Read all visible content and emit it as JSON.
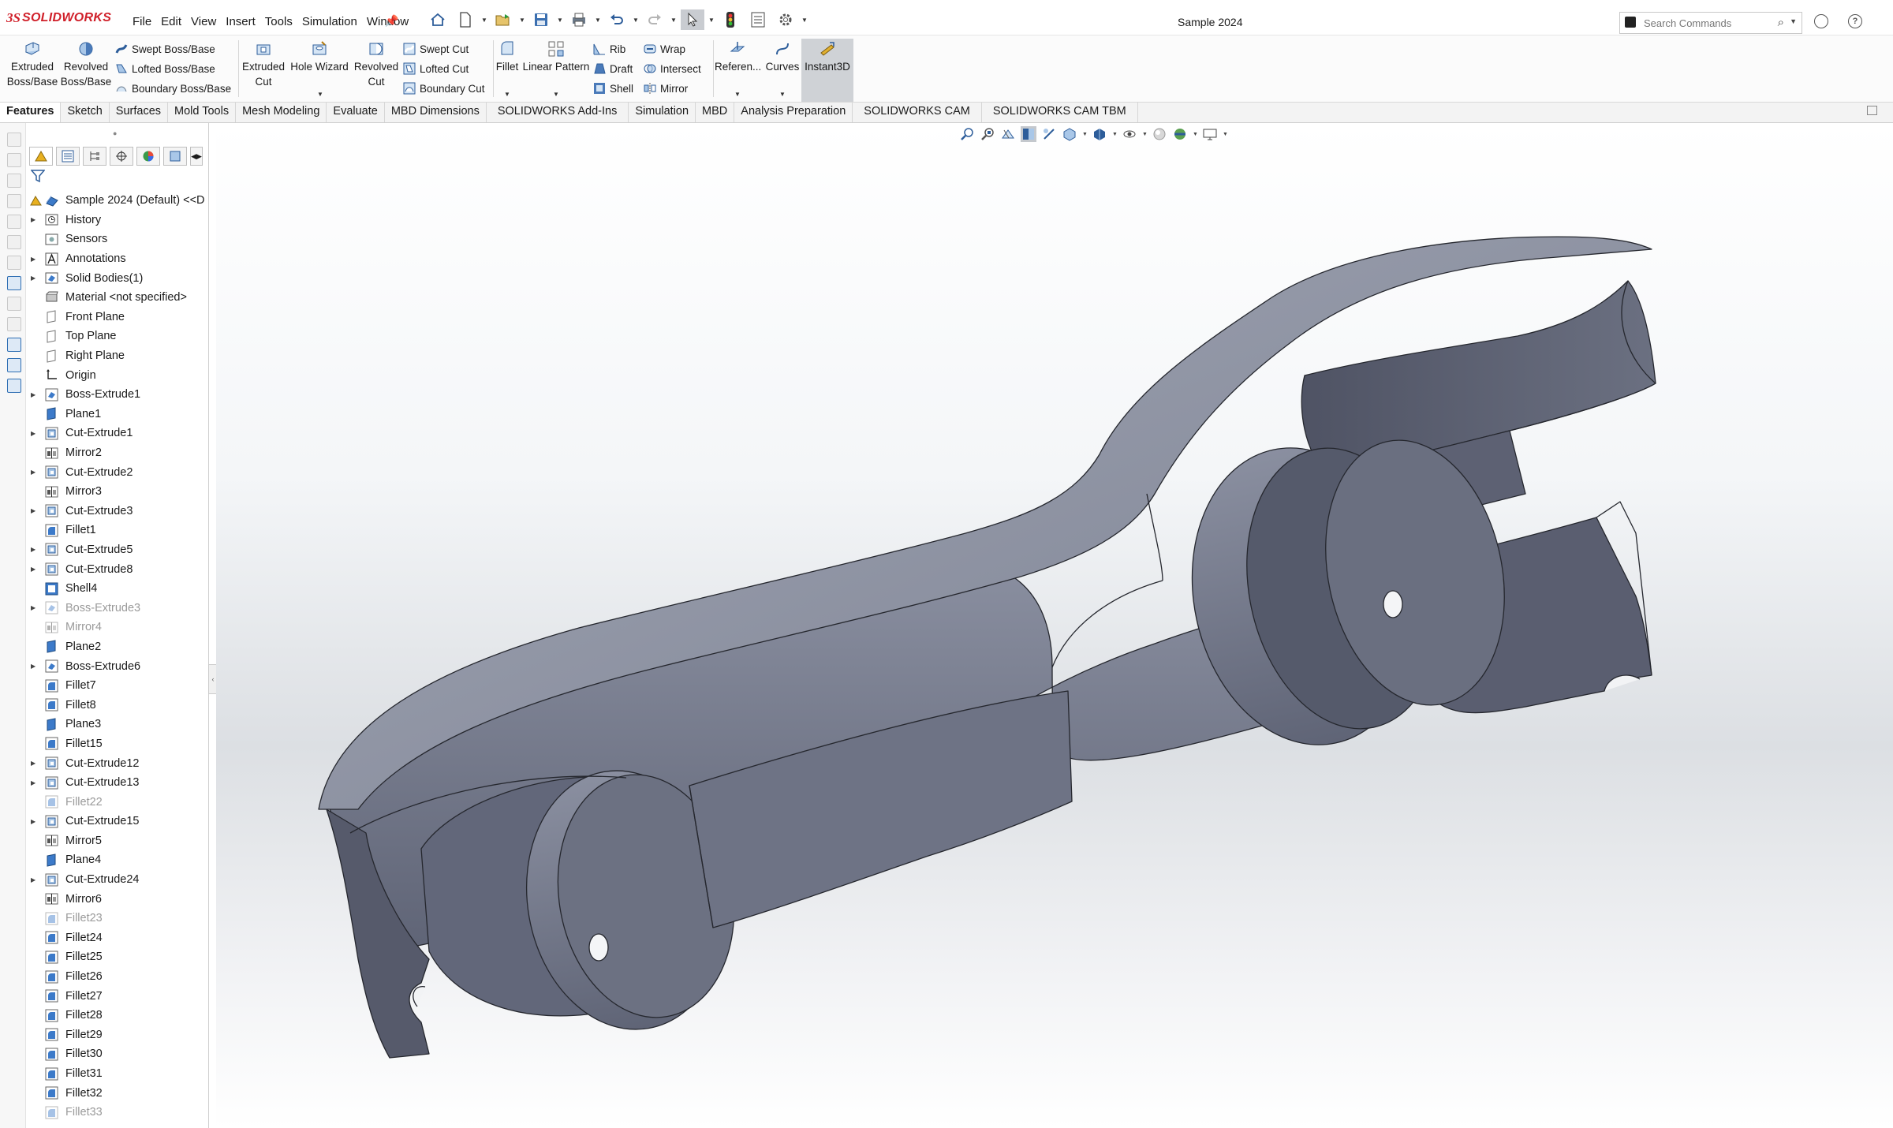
{
  "app": {
    "logo_ds": "3S",
    "logo_text": "SOLIDWORKS",
    "document_title": "Sample 2024"
  },
  "menu": [
    "File",
    "Edit",
    "View",
    "Insert",
    "Tools",
    "Simulation",
    "Window"
  ],
  "quick_access_icons": [
    "home-icon",
    "new-document-icon",
    "open-icon",
    "save-icon",
    "print-icon",
    "undo-icon",
    "redo-icon",
    "select-icon",
    "rebuild-icon",
    "file-properties-icon",
    "options-icon"
  ],
  "search": {
    "placeholder": "Search Commands"
  },
  "ribbon": {
    "extruded_boss": [
      "Extruded",
      "Boss/Base"
    ],
    "revolved_boss": [
      "Revolved",
      "Boss/Base"
    ],
    "swept_boss": "Swept Boss/Base",
    "lofted_boss": "Lofted Boss/Base",
    "boundary_boss": "Boundary Boss/Base",
    "extruded_cut": [
      "Extruded",
      "Cut"
    ],
    "hole_wizard": "Hole Wizard",
    "revolved_cut": [
      "Revolved",
      "Cut"
    ],
    "swept_cut": "Swept Cut",
    "lofted_cut": "Lofted Cut",
    "boundary_cut": "Boundary Cut",
    "fillet": "Fillet",
    "linear_pattern": "Linear Pattern",
    "rib": "Rib",
    "draft": "Draft",
    "shell": "Shell",
    "wrap": "Wrap",
    "intersect": "Intersect",
    "mirror": "Mirror",
    "reference": "Referen...",
    "curves": "Curves",
    "instant3d": "Instant3D"
  },
  "tabs": [
    {
      "label": "Features",
      "active": true
    },
    {
      "label": "Sketch"
    },
    {
      "label": "Surfaces"
    },
    {
      "label": "Mold Tools"
    },
    {
      "label": "Mesh Modeling"
    },
    {
      "label": "Evaluate"
    },
    {
      "label": "MBD Dimensions"
    },
    {
      "label": "SOLIDWORKS Add-Ins"
    },
    {
      "label": "Simulation"
    },
    {
      "label": "MBD"
    },
    {
      "label": "Analysis Preparation"
    },
    {
      "label": "SOLIDWORKS CAM"
    },
    {
      "label": "SOLIDWORKS CAM TBM"
    }
  ],
  "tree": {
    "root": "Sample 2024 (Default) <<D",
    "items": [
      {
        "label": "History",
        "icon": "history-icon",
        "expandable": true
      },
      {
        "label": "Sensors",
        "icon": "sensor-icon"
      },
      {
        "label": "Annotations",
        "icon": "annotation-icon",
        "expandable": true
      },
      {
        "label": "Solid Bodies(1)",
        "icon": "solid-bodies-icon",
        "expandable": true
      },
      {
        "label": "Material <not specified>",
        "icon": "material-icon"
      },
      {
        "label": "Front Plane",
        "icon": "plane-icon"
      },
      {
        "label": "Top Plane",
        "icon": "plane-icon"
      },
      {
        "label": "Right Plane",
        "icon": "plane-icon"
      },
      {
        "label": "Origin",
        "icon": "origin-icon"
      },
      {
        "label": "Boss-Extrude1",
        "icon": "extrude-icon",
        "expandable": true
      },
      {
        "label": "Plane1",
        "icon": "plane-solid-icon"
      },
      {
        "label": "Cut-Extrude1",
        "icon": "cut-extrude-icon",
        "expandable": true
      },
      {
        "label": "Mirror2",
        "icon": "mirror-icon"
      },
      {
        "label": "Cut-Extrude2",
        "icon": "cut-extrude-icon",
        "expandable": true
      },
      {
        "label": "Mirror3",
        "icon": "mirror-icon"
      },
      {
        "label": "Cut-Extrude3",
        "icon": "cut-extrude-icon",
        "expandable": true
      },
      {
        "label": "Fillet1",
        "icon": "fillet-icon"
      },
      {
        "label": "Cut-Extrude5",
        "icon": "cut-extrude-icon",
        "expandable": true
      },
      {
        "label": "Cut-Extrude8",
        "icon": "cut-extrude-icon",
        "expandable": true
      },
      {
        "label": "Shell4",
        "icon": "shell-icon"
      },
      {
        "label": "Boss-Extrude3",
        "icon": "extrude-icon",
        "expandable": true,
        "suppressed": true
      },
      {
        "label": "Mirror4",
        "icon": "mirror-icon",
        "suppressed": true
      },
      {
        "label": "Plane2",
        "icon": "plane-solid-icon"
      },
      {
        "label": "Boss-Extrude6",
        "icon": "extrude-icon",
        "expandable": true
      },
      {
        "label": "Fillet7",
        "icon": "fillet-icon"
      },
      {
        "label": "Fillet8",
        "icon": "fillet-icon"
      },
      {
        "label": "Plane3",
        "icon": "plane-solid-icon"
      },
      {
        "label": "Fillet15",
        "icon": "fillet-icon"
      },
      {
        "label": "Cut-Extrude12",
        "icon": "cut-extrude-icon",
        "expandable": true
      },
      {
        "label": "Cut-Extrude13",
        "icon": "cut-extrude-icon",
        "expandable": true
      },
      {
        "label": "Fillet22",
        "icon": "fillet-icon",
        "suppressed": true
      },
      {
        "label": "Cut-Extrude15",
        "icon": "cut-extrude-icon",
        "expandable": true
      },
      {
        "label": "Mirror5",
        "icon": "mirror-icon"
      },
      {
        "label": "Plane4",
        "icon": "plane-solid-icon"
      },
      {
        "label": "Cut-Extrude24",
        "icon": "cut-extrude-icon",
        "expandable": true
      },
      {
        "label": "Mirror6",
        "icon": "mirror-icon"
      },
      {
        "label": "Fillet23",
        "icon": "fillet-icon",
        "suppressed": true
      },
      {
        "label": "Fillet24",
        "icon": "fillet-icon"
      },
      {
        "label": "Fillet25",
        "icon": "fillet-icon"
      },
      {
        "label": "Fillet26",
        "icon": "fillet-icon"
      },
      {
        "label": "Fillet27",
        "icon": "fillet-icon"
      },
      {
        "label": "Fillet28",
        "icon": "fillet-icon"
      },
      {
        "label": "Fillet29",
        "icon": "fillet-icon"
      },
      {
        "label": "Fillet30",
        "icon": "fillet-icon"
      },
      {
        "label": "Fillet31",
        "icon": "fillet-icon"
      },
      {
        "label": "Fillet32",
        "icon": "fillet-icon"
      },
      {
        "label": "Fillet33",
        "icon": "fillet-icon",
        "suppressed": true
      }
    ]
  },
  "heads_up_toolbar": [
    "zoom-to-fit-icon",
    "zoom-to-area-icon",
    "previous-view-icon",
    "section-view-icon",
    "dynamic-annotation-icon",
    "view-orientation-icon",
    "display-style-icon",
    "hide-show-items-icon",
    "edit-appearance-icon",
    "apply-scene-icon",
    "view-settings-icon"
  ],
  "colors": {
    "accent": "#d0202a",
    "model_face": "#6b7081",
    "model_dark": "#4c5060",
    "model_light": "#9a9fae",
    "model_edge": "#25272e"
  }
}
